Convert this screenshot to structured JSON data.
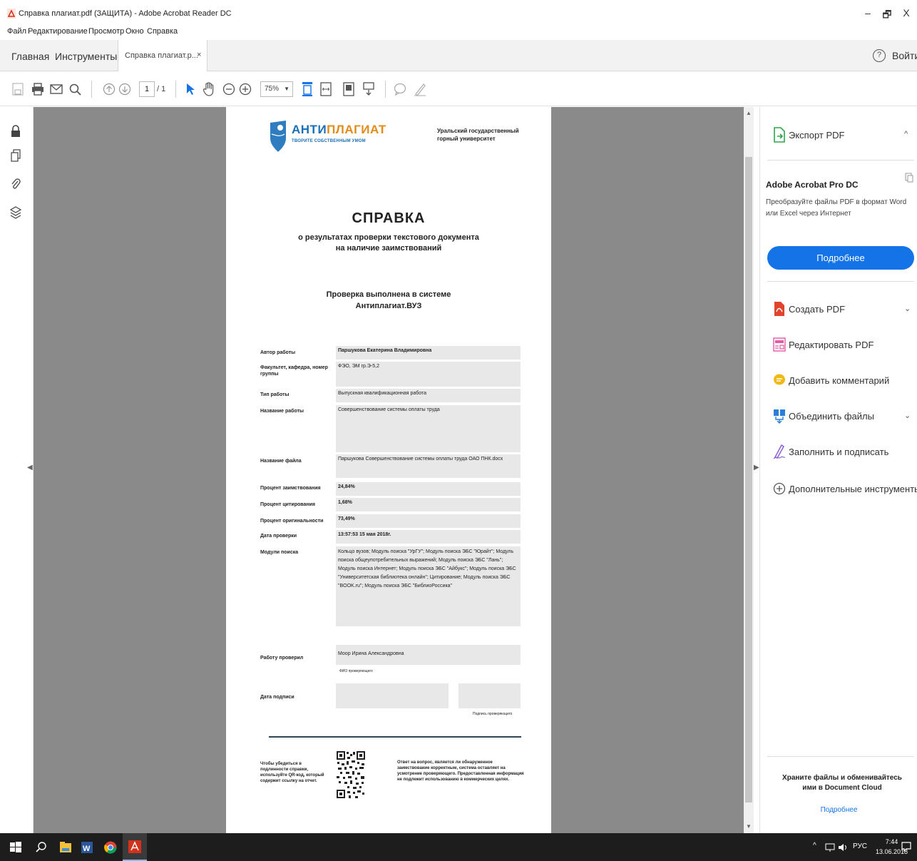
{
  "window": {
    "title": "Справка плагиат.pdf (ЗАЩИТА) - Adobe Acrobat Reader DC",
    "controls": {
      "minimize": "–",
      "maximize": "🗗",
      "close": "X"
    }
  },
  "menu": [
    "Файл",
    "Редактирование",
    "Просмотр",
    "Окно",
    "Справка"
  ],
  "tabs": {
    "home": "Главная",
    "tools": "Инструменты",
    "doc": "Справка плагиат.p...",
    "doc_close": "×",
    "help": "?",
    "signin": "Войти"
  },
  "toolbar": {
    "page_current": "1",
    "page_total": "/ 1",
    "zoom": "75%",
    "icons": [
      "save-icon",
      "print-icon",
      "email-icon",
      "search-icon",
      "prev-page-icon",
      "next-page-icon",
      "select-cursor-icon",
      "hand-tool-icon",
      "zoom-out-icon",
      "zoom-in-icon",
      "fit-page-icon",
      "fit-width-icon",
      "full-screen-icon",
      "scroll-mode-icon",
      "comment-icon",
      "pen-icon"
    ]
  },
  "document": {
    "logo": {
      "part1": "АНТИ",
      "part2": "ПЛАГИАТ",
      "tagline": "ТВОРИТЕ СОБСТВЕННЫМ УМОМ"
    },
    "university": "Уральский государственный горный университет",
    "heading": "СПРАВКА",
    "subheading1": "о результатах проверки текстового документа",
    "subheading2": "на наличие заимствований",
    "system1": "Проверка выполнена в системе",
    "system2": "Антиплагиат.ВУЗ",
    "fields": {
      "author_label": "Автор работы",
      "author": "Паршукова Екатерина Владимировна",
      "faculty_label": "Факультет, кафедра, номер группы",
      "faculty": "ФЭО, ЭМ гр.Э-5,2",
      "type_label": "Тип работы",
      "type": "Выпускная квалификационная работа",
      "title_label": "Название работы",
      "title": "Совершенствование системы оплаты труда",
      "file_label": "Название файла",
      "file": "Паршукова Совершенствование системы оплаты труда ОАО ПНК.docx",
      "borrow_label": "Процент заимствования",
      "borrow": "24,84%",
      "cite_label": "Процент цитирования",
      "cite": "1,68%",
      "orig_label": "Процент оригинальности",
      "orig": "73,49%",
      "date_label": "Дата проверки",
      "date": "13:57:53  15 мая 2018г.",
      "modules_label": "Модули поиска",
      "modules": "Кольцо вузов; Модуль поиска \"УрГУ\"; Модуль поиска ЭБС \"Юрайт\"; Модуль поиска общеупотребительных выражений; Модуль поиска ЭБС \"Лань\"; Модуль поиска Интернет; Модуль поиска ЭБС \"Айбукс\"; Модуль поиска ЭБС \"Университетская библиотека онлайн\"; Цитирование; Модуль поиска ЭБС \"BOOK.ru\"; Модуль поиска ЭБС \"БиблиоРоссика\"",
      "checker_label": "Работу проверил",
      "checker": "Моор Ирина Александровна",
      "checker_note": "ФИО проверяющего",
      "sign_date_label": "Дата подписи",
      "sign_note": "Подпись проверяющего"
    },
    "footer_left": "Чтобы убедиться в подлинности справки, используйте QR-код, который содержит ссылку на отчет.",
    "footer_right": "Ответ на вопрос, является ли обнаруженное заимствование корректным, система оставляет на усмотрение проверяющего. Предоставленная информация не подлежит использованию в коммерческих целях."
  },
  "rightpanel": {
    "export": "Экспорт PDF",
    "promo_title": "Adobe Acrobat Pro DC",
    "promo_desc": "Преобразуйте файлы PDF в формат Word или Excel через Интернет",
    "promo_button": "Подробнее",
    "tools": [
      {
        "label": "Создать PDF",
        "chevron": "⌄",
        "color": "#e0442e"
      },
      {
        "label": "Редактировать PDF",
        "chevron": "",
        "color": "#e45ba6"
      },
      {
        "label": "Добавить комментарий",
        "chevron": "",
        "color": "#f2b915"
      },
      {
        "label": "Объединить файлы",
        "chevron": "⌄",
        "color": "#2b7fd8"
      },
      {
        "label": "Заполнить и подписать",
        "chevron": "",
        "color": "#8b5fd1"
      },
      {
        "label": "Дополнительные инструменты",
        "chevron": "",
        "color": "#555555"
      }
    ],
    "cloud_text": "Храните файлы и обменивайтесь ими в Document Cloud",
    "cloud_link": "Подробнее"
  },
  "taskbar": {
    "lang": "РУС",
    "time": "7:44",
    "date": "13.06.2018"
  }
}
